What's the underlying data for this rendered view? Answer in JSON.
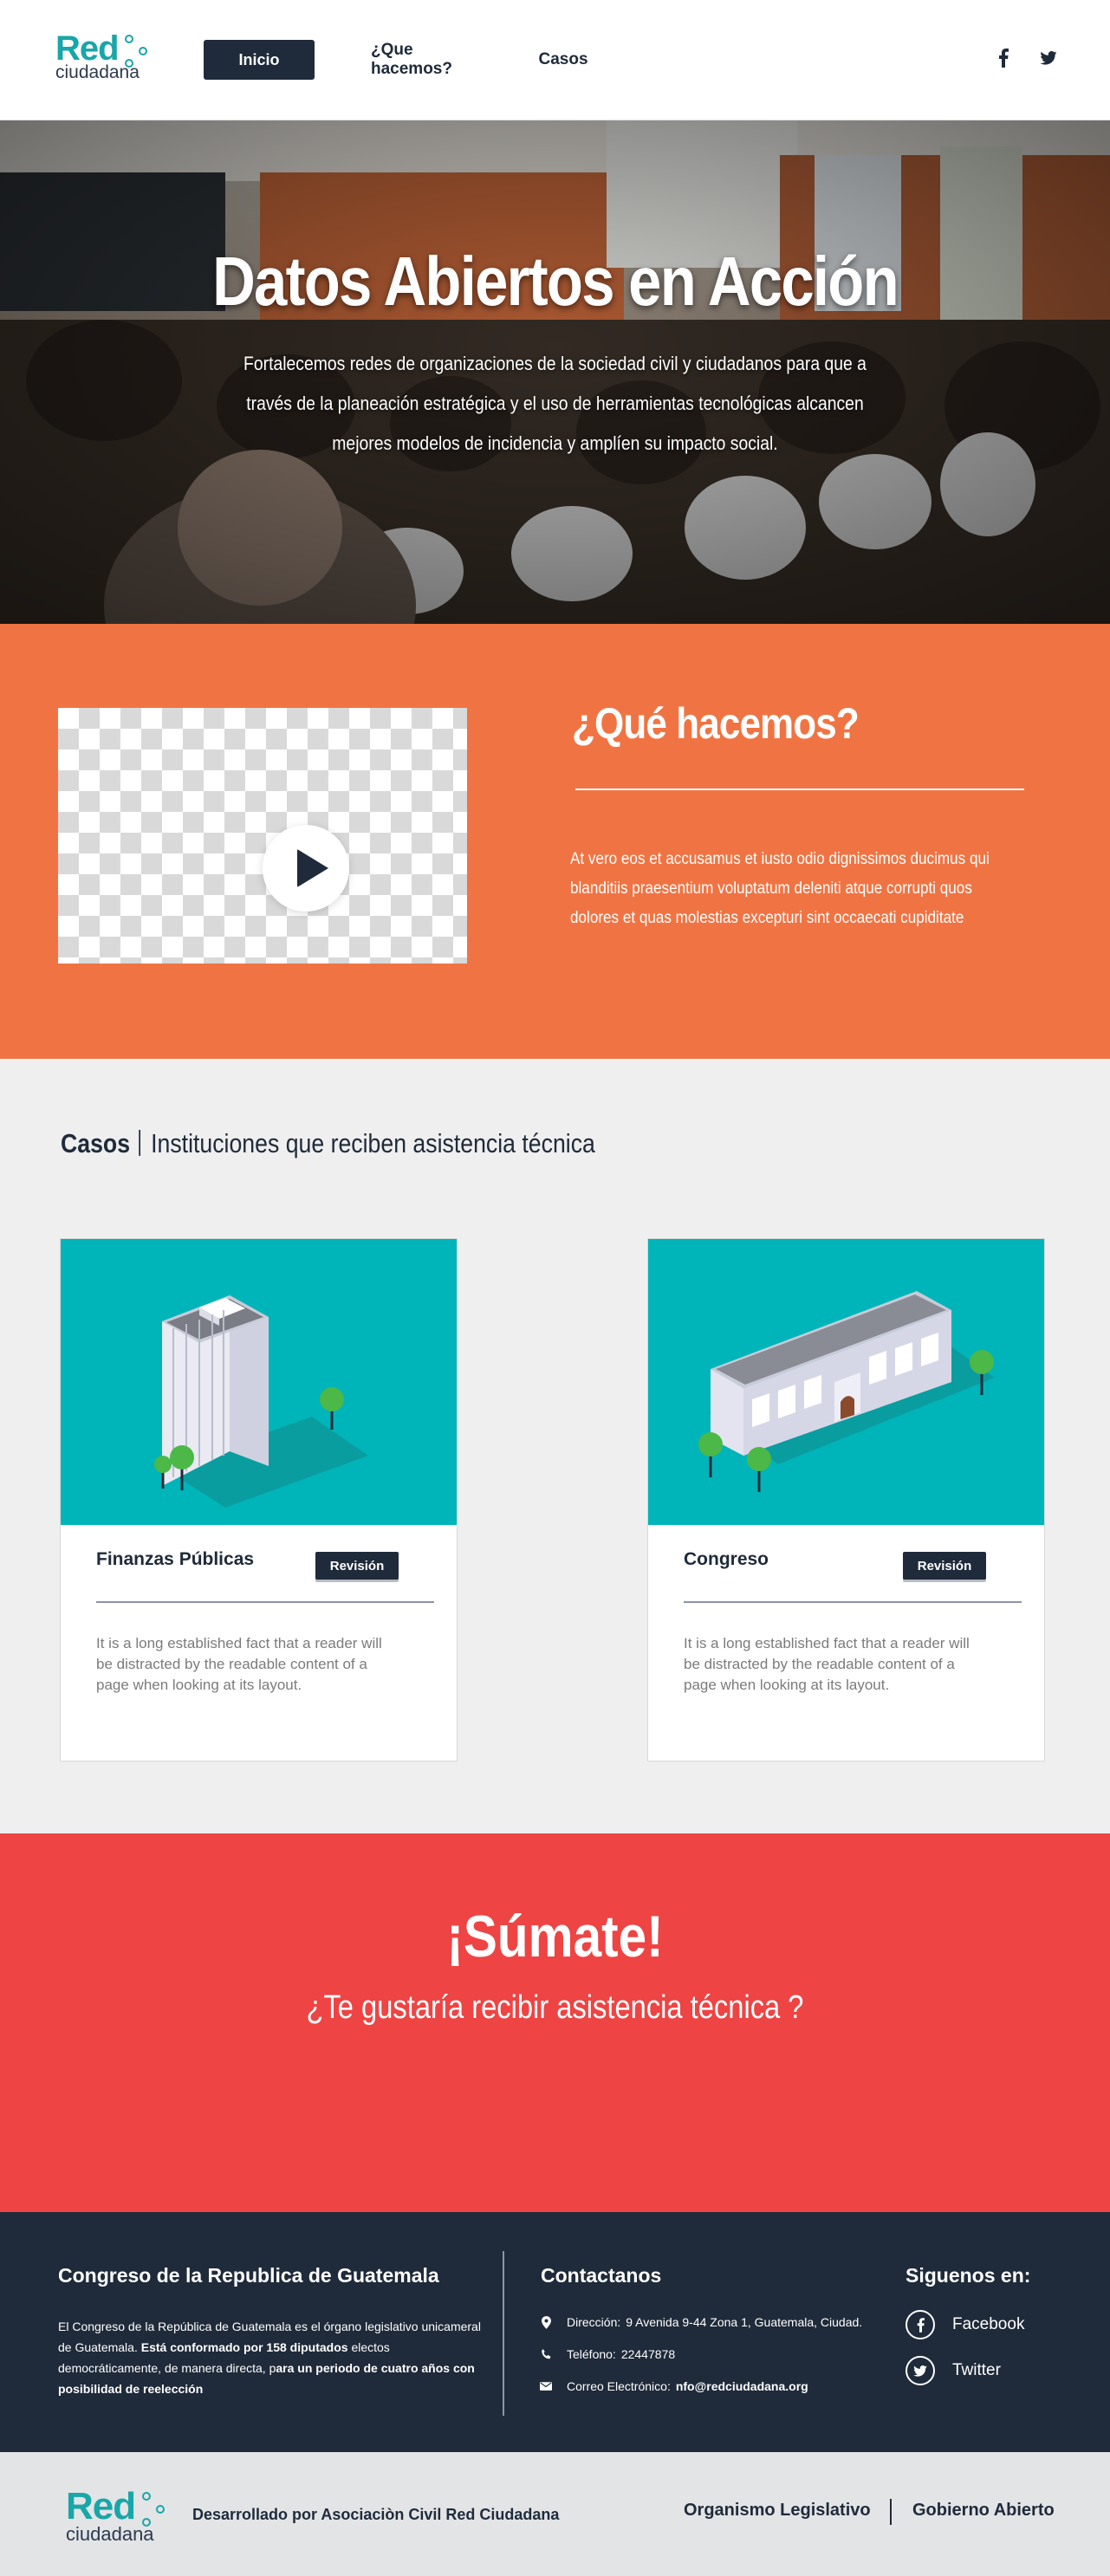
{
  "brand": {
    "logo_main": "Red",
    "logo_sub": "ciudadana",
    "accent_color": "#19a6a8",
    "dark_color": "#1f2a3a"
  },
  "nav": {
    "home": "Inicio",
    "what": "¿Que hacemos?",
    "cases": "Casos",
    "social": [
      {
        "icon": "facebook-icon",
        "glyph": "f"
      },
      {
        "icon": "twitter-icon",
        "glyph": "t"
      }
    ]
  },
  "hero": {
    "title": "Datos Abiertos en Acción",
    "text": "Fortalecemos redes de organizaciones de la sociedad civil y ciudadanos para que a través de la planeación estratégica y el uso de herramientas tecnológicas alcancen mejores modelos de incidencia y amplíen su impacto social."
  },
  "what": {
    "title": "¿Qué hacemos?",
    "text": "At vero eos et accusamus et iusto odio dignissimos ducimus qui blanditiis praesentium voluptatum deleniti atque corrupti quos dolores et quas molestias excepturi sint occaecati cupiditate",
    "bg_color": "#f07443"
  },
  "cases": {
    "heading_bold": "Casos",
    "heading_rest": "Instituciones que reciben asistencia técnica",
    "cards": [
      {
        "name": "Finanzas Públicas",
        "badge": "Revisión",
        "desc": "It is a long established fact that a reader will be distracted by the readable content of a page when looking at its layout."
      },
      {
        "name": "Congreso",
        "badge": "Revisión",
        "desc": "It is a long established fact that a reader will be distracted by the readable content of a page when looking at its layout."
      }
    ]
  },
  "join": {
    "title": "¡Súmate!",
    "subtitle": "¿Te gustaría recibir asistencia técnica ?",
    "bg_color": "#ee4444"
  },
  "footer": {
    "org_title": "Congreso de la Republica de Guatemala",
    "org_text_1": "El Congreso de la República de Guatemala es el órgano legislativo unicameral de Guatemala. ",
    "org_text_2": "Está conformado por 158 diputados",
    "org_text_3": " electos democráticamente, de manera directa, p",
    "org_text_4": "ara un periodo de cuatro años con posibilidad de reelección",
    "contact_title": "Contactanos",
    "address_label": "Dirección:",
    "address_value": "9 Avenida 9-44 Zona 1, Guatemala, Ciudad.",
    "phone_label": "Teléfono:",
    "phone_value": "22447878",
    "email_label": "Correo Electrónico:",
    "email_value": "nfo@redciudadana.org",
    "follow_title": "Siguenos en:",
    "facebook": "Facebook",
    "twitter": "Twitter"
  },
  "bottom": {
    "developed_by": "Desarrollado por Asociaciòn Civil Red Ciudadana",
    "link_1": "Organismo Legislativo",
    "link_2": "Gobierno Abierto"
  }
}
